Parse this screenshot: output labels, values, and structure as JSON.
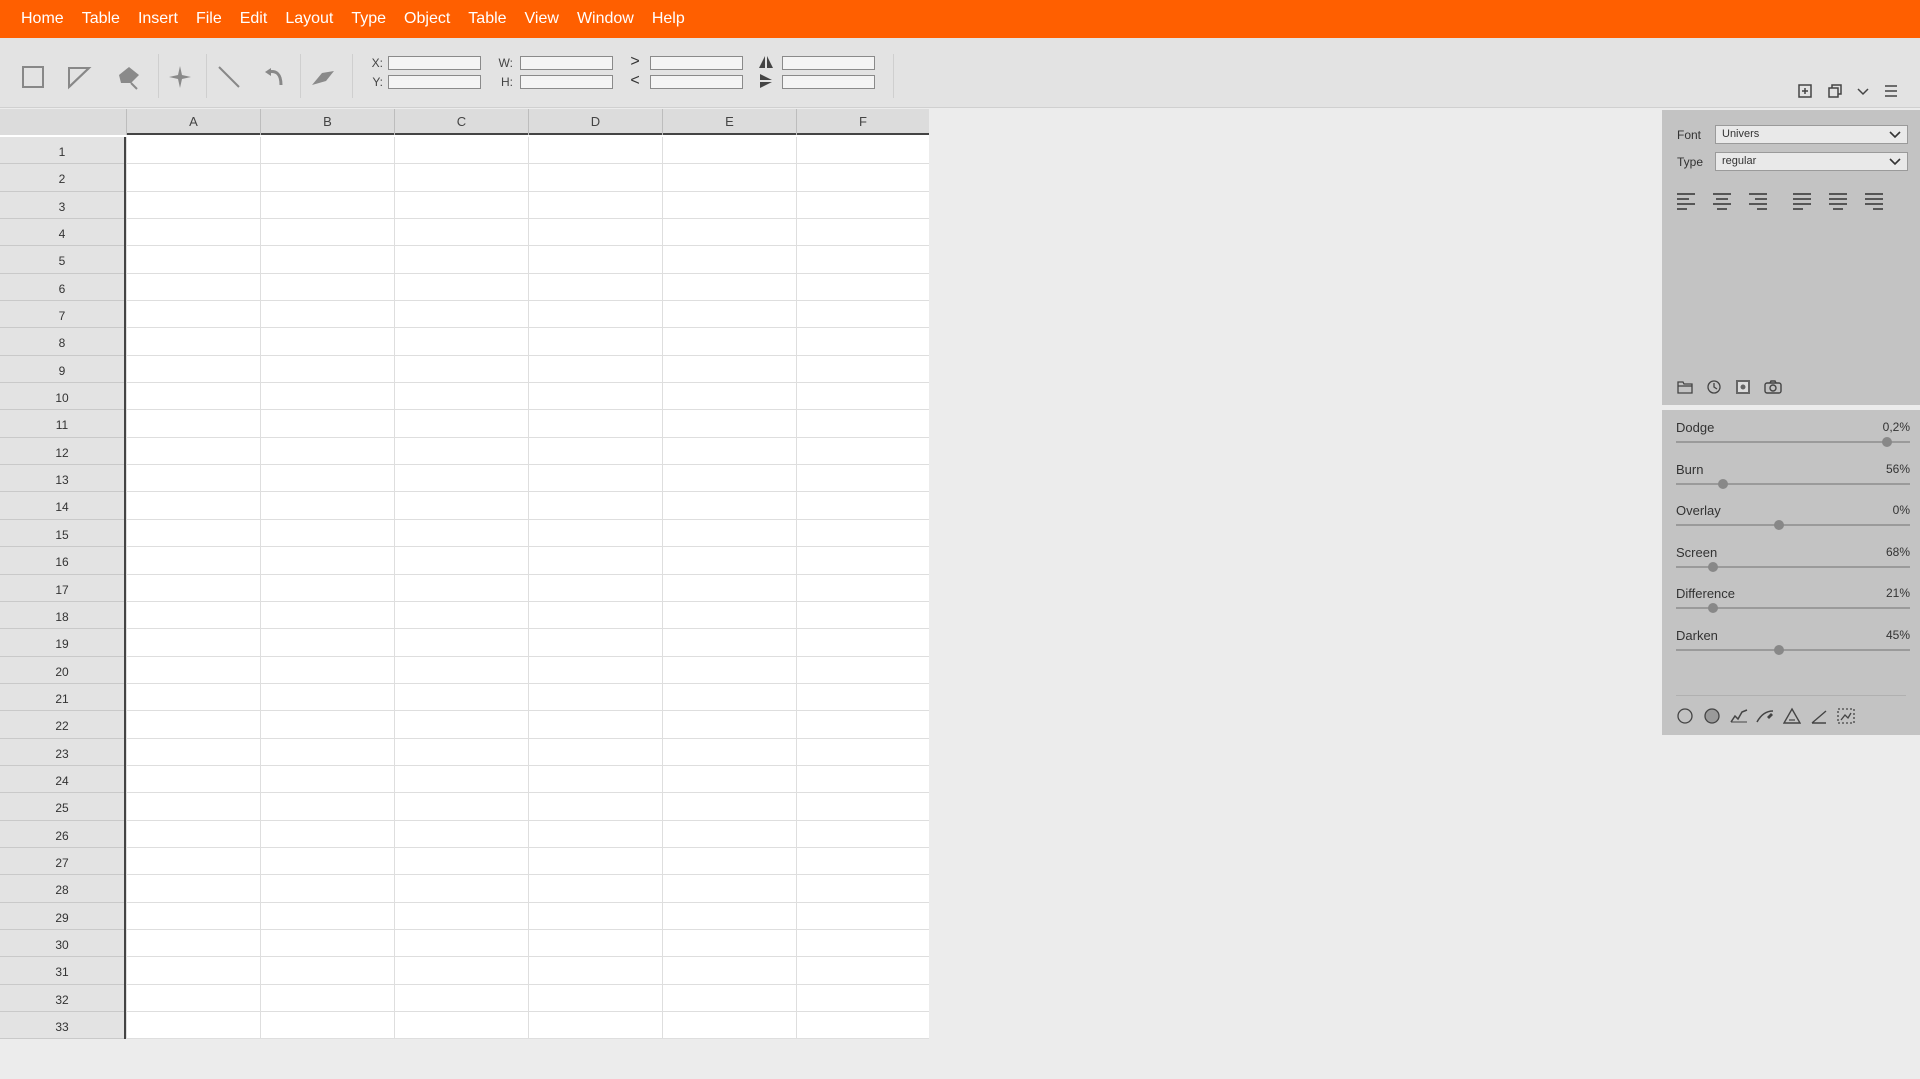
{
  "menu": [
    "Home",
    "Table",
    "Insert",
    "File",
    "Edit",
    "Layout",
    "Type",
    "Object",
    "Table",
    "View",
    "Window",
    "Help"
  ],
  "toolbar": {
    "tools": [
      "rectangle-tool",
      "triangle-tool",
      "pen-tool",
      "star-tool",
      "line-tool",
      "rotate-tool",
      "arrow-tool"
    ],
    "x_label": "X:",
    "y_label": "Y:",
    "w_label": "W:",
    "h_label": "H:",
    "x_value": "",
    "y_value": "",
    "w_value": "",
    "h_value": "",
    "gt_symbol": ">",
    "lt_symbol": "<",
    "field3_value": "",
    "field4_value": "",
    "field5_value": "",
    "field6_value": ""
  },
  "sheet": {
    "columns": [
      "A",
      "B",
      "C",
      "D",
      "E",
      "F"
    ],
    "rows": [
      "1",
      "2",
      "3",
      "4",
      "5",
      "6",
      "7",
      "8",
      "9",
      "10",
      "11",
      "12",
      "13",
      "14",
      "15",
      "16",
      "17",
      "18",
      "19",
      "20",
      "21",
      "22",
      "23",
      "24",
      "25",
      "26",
      "27",
      "28",
      "29",
      "30",
      "31",
      "32",
      "33"
    ]
  },
  "panel": {
    "font_label": "Font",
    "font_value": "Univers",
    "type_label": "Type",
    "type_value": "regular",
    "sliders": [
      {
        "name": "Dodge",
        "value": "0,2%",
        "level": 0.9
      },
      {
        "name": "Burn",
        "value": "56%",
        "level": 0.2
      },
      {
        "name": "Overlay",
        "value": "0%",
        "level": 0.44
      },
      {
        "name": "Screen",
        "value": "68%",
        "level": 0.16
      },
      {
        "name": "Difference",
        "value": "21%",
        "level": 0.16
      },
      {
        "name": "Darken",
        "value": "45%",
        "level": 0.44
      }
    ]
  },
  "colors": {
    "accent": "#ff5f00",
    "panel": "#c3c3c3",
    "toolbar": "#e3e3e3"
  }
}
